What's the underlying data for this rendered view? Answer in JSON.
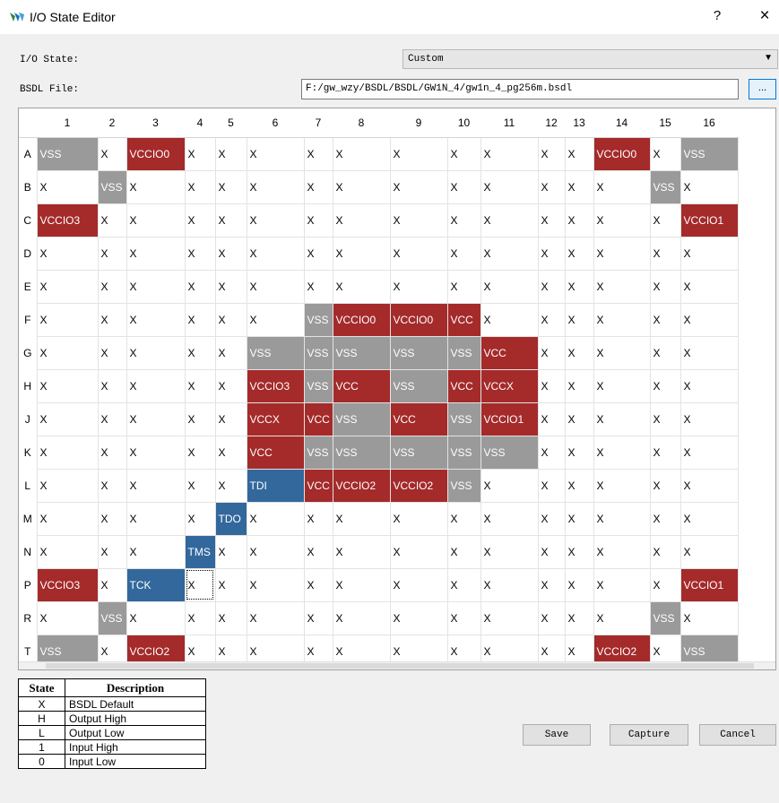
{
  "window": {
    "title": "I/O State Editor",
    "help": "?",
    "close": "×"
  },
  "io_state": {
    "label": "I/O State:",
    "value": "Custom"
  },
  "bsdl": {
    "label": "BSDL File:",
    "value": "F:/gw_wzy/BSDL/BSDL/GW1N_4/gw1n_4_pg256m.bsdl",
    "browse": "..."
  },
  "grid": {
    "columns": [
      "1",
      "2",
      "3",
      "4",
      "5",
      "6",
      "7",
      "8",
      "9",
      "10",
      "11",
      "12",
      "13",
      "14",
      "15",
      "16"
    ],
    "rows": [
      {
        "label": "A",
        "cells": [
          "VSS",
          "X",
          "VCCIO0",
          "X",
          "X",
          "X",
          "X",
          "X",
          "X",
          "X",
          "X",
          "X",
          "X",
          "VCCIO0",
          "X",
          "VSS"
        ]
      },
      {
        "label": "B",
        "cells": [
          "X",
          "VSS",
          "X",
          "X",
          "X",
          "X",
          "X",
          "X",
          "X",
          "X",
          "X",
          "X",
          "X",
          "X",
          "VSS",
          "X"
        ]
      },
      {
        "label": "C",
        "cells": [
          "VCCIO3",
          "X",
          "X",
          "X",
          "X",
          "X",
          "X",
          "X",
          "X",
          "X",
          "X",
          "X",
          "X",
          "X",
          "X",
          "VCCIO1"
        ]
      },
      {
        "label": "D",
        "cells": [
          "X",
          "X",
          "X",
          "X",
          "X",
          "X",
          "X",
          "X",
          "X",
          "X",
          "X",
          "X",
          "X",
          "X",
          "X",
          "X"
        ]
      },
      {
        "label": "E",
        "cells": [
          "X",
          "X",
          "X",
          "X",
          "X",
          "X",
          "X",
          "X",
          "X",
          "X",
          "X",
          "X",
          "X",
          "X",
          "X",
          "X"
        ]
      },
      {
        "label": "F",
        "cells": [
          "X",
          "X",
          "X",
          "X",
          "X",
          "X",
          "VSS",
          "VCCIO0",
          "VCCIO0",
          "VCC",
          "X",
          "X",
          "X",
          "X",
          "X",
          "X"
        ]
      },
      {
        "label": "G",
        "cells": [
          "X",
          "X",
          "X",
          "X",
          "X",
          "VSS",
          "VSS",
          "VSS",
          "VSS",
          "VSS",
          "VCC",
          "X",
          "X",
          "X",
          "X",
          "X"
        ]
      },
      {
        "label": "H",
        "cells": [
          "X",
          "X",
          "X",
          "X",
          "X",
          "VCCIO3",
          "VSS",
          "VCC",
          "VSS",
          "VCC",
          "VCCX",
          "X",
          "X",
          "X",
          "X",
          "X"
        ]
      },
      {
        "label": "J",
        "cells": [
          "X",
          "X",
          "X",
          "X",
          "X",
          "VCCX",
          "VCC",
          "VSS",
          "VCC",
          "VSS",
          "VCCIO1",
          "X",
          "X",
          "X",
          "X",
          "X"
        ]
      },
      {
        "label": "K",
        "cells": [
          "X",
          "X",
          "X",
          "X",
          "X",
          "VCC",
          "VSS",
          "VSS",
          "VSS",
          "VSS",
          "VSS",
          "X",
          "X",
          "X",
          "X",
          "X"
        ]
      },
      {
        "label": "L",
        "cells": [
          "X",
          "X",
          "X",
          "X",
          "X",
          "TDI",
          "VCC",
          "VCCIO2",
          "VCCIO2",
          "VSS",
          "X",
          "X",
          "X",
          "X",
          "X",
          "X"
        ]
      },
      {
        "label": "M",
        "cells": [
          "X",
          "X",
          "X",
          "X",
          "TDO",
          "X",
          "X",
          "X",
          "X",
          "X",
          "X",
          "X",
          "X",
          "X",
          "X",
          "X"
        ]
      },
      {
        "label": "N",
        "cells": [
          "X",
          "X",
          "X",
          "TMS",
          "X",
          "X",
          "X",
          "X",
          "X",
          "X",
          "X",
          "X",
          "X",
          "X",
          "X",
          "X"
        ]
      },
      {
        "label": "P",
        "cells": [
          "VCCIO3",
          "X",
          "TCK",
          "X",
          "X",
          "X",
          "X",
          "X",
          "X",
          "X",
          "X",
          "X",
          "X",
          "X",
          "X",
          "VCCIO1"
        ]
      },
      {
        "label": "R",
        "cells": [
          "X",
          "VSS",
          "X",
          "X",
          "X",
          "X",
          "X",
          "X",
          "X",
          "X",
          "X",
          "X",
          "X",
          "X",
          "VSS",
          "X"
        ]
      },
      {
        "label": "T",
        "cells": [
          "VSS",
          "X",
          "VCCIO2",
          "X",
          "X",
          "X",
          "X",
          "X",
          "X",
          "X",
          "X",
          "X",
          "X",
          "VCCIO2",
          "X",
          "VSS"
        ]
      }
    ],
    "selected": {
      "row": "P",
      "col": "4"
    },
    "colors": {
      "ground": "#9a9a9a",
      "power": "#a52a2a",
      "jtag": "#32689c"
    }
  },
  "legend": {
    "headers": [
      "State",
      "Description"
    ],
    "rows": [
      {
        "state": "X",
        "desc": "BSDL Default"
      },
      {
        "state": "H",
        "desc": "Output High"
      },
      {
        "state": "L",
        "desc": "Output Low"
      },
      {
        "state": "1",
        "desc": "Input High"
      },
      {
        "state": "0",
        "desc": "Input Low"
      }
    ]
  },
  "buttons": {
    "save": "Save",
    "capture": "Capture",
    "cancel": "Cancel"
  }
}
